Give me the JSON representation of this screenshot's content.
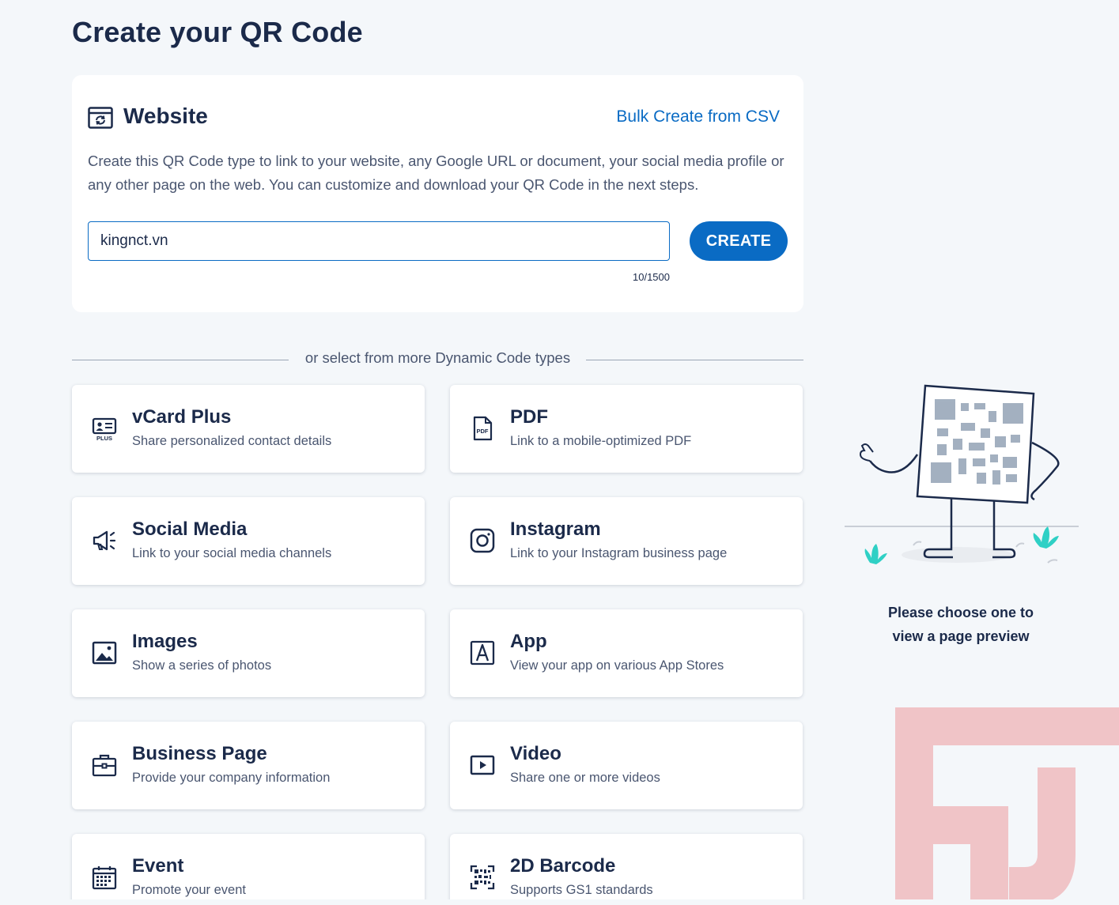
{
  "page": {
    "title": "Create your QR Code"
  },
  "website_card": {
    "icon": "browser-refresh-icon",
    "title": "Website",
    "bulk_link": "Bulk Create from CSV",
    "description": "Create this QR Code type to link to your website, any Google URL or document, your social media profile or any other page on the web. You can customize and download your QR Code in the next steps.",
    "url_input": {
      "value": "kingnct.vn",
      "placeholder": ""
    },
    "char_counter": "10/1500",
    "create_button": "CREATE"
  },
  "divider_text": "or select from more Dynamic Code types",
  "code_types": [
    {
      "icon": "vcard-plus-icon",
      "name": "vCard Plus",
      "description": "Share personalized contact details",
      "icon_sub": "PLUS"
    },
    {
      "icon": "pdf-icon",
      "name": "PDF",
      "description": "Link to a mobile-optimized PDF",
      "icon_sub": "PDF"
    },
    {
      "icon": "megaphone-icon",
      "name": "Social Media",
      "description": "Link to your social media channels"
    },
    {
      "icon": "instagram-icon",
      "name": "Instagram",
      "description": "Link to your Instagram business page"
    },
    {
      "icon": "image-icon",
      "name": "Images",
      "description": "Show a series of photos"
    },
    {
      "icon": "app-store-icon",
      "name": "App",
      "description": "View your app on various App Stores"
    },
    {
      "icon": "briefcase-icon",
      "name": "Business Page",
      "description": "Provide your company information"
    },
    {
      "icon": "video-play-icon",
      "name": "Video",
      "description": "Share one or more videos"
    },
    {
      "icon": "calendar-icon",
      "name": "Event",
      "description": "Promote your event"
    },
    {
      "icon": "barcode-2d-icon",
      "name": "2D Barcode",
      "description": "Supports GS1 standards"
    }
  ],
  "preview": {
    "illustration": "qr-character-thumbs-up-illustration",
    "line1": "Please choose one to",
    "line2": "view a page preview"
  },
  "colors": {
    "background": "#f4f7fa",
    "primary": "#0a6bc4",
    "heading": "#1b2a4a",
    "body_text": "#4a5670",
    "watermark": "#f0c4c7",
    "plant": "#2fd0c5"
  }
}
